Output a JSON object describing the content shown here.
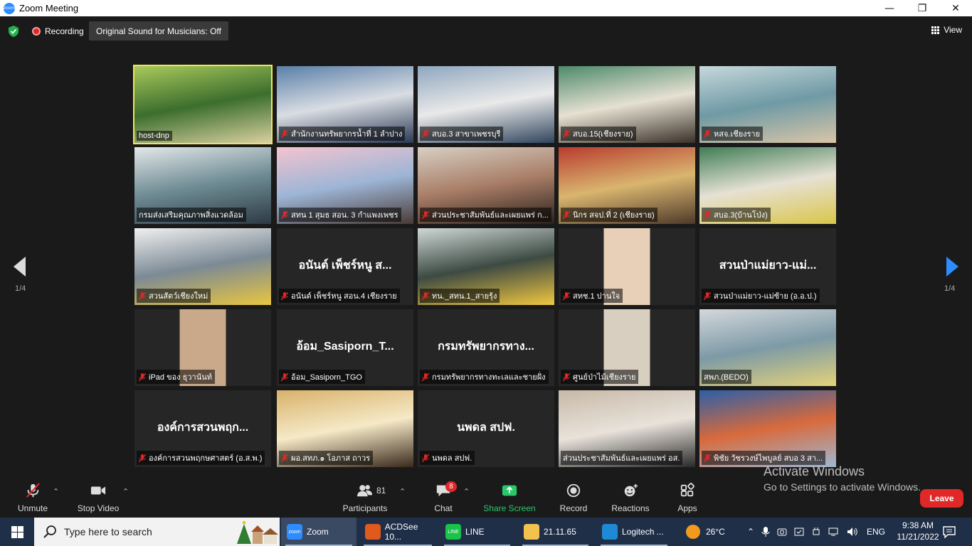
{
  "window": {
    "title": "Zoom Meeting",
    "app_icon_text": "zoom",
    "minimize": "—",
    "maximize": "❐",
    "close": "✕"
  },
  "status": {
    "recording_label": "Recording",
    "original_sound_label": "Original Sound for Musicians: Off",
    "view_label": "View"
  },
  "pager": {
    "left_page": "1/4",
    "right_page": "1/4"
  },
  "tiles": [
    {
      "label": "host-dnp",
      "muted": false,
      "active": true,
      "bg": [
        "#a9c95a",
        "#3c6e2e",
        "#d8d0a0"
      ],
      "bigname": ""
    },
    {
      "label": "สำนักงานทรัพยากรน้ำที่ 1 ลำปาง",
      "muted": true,
      "active": false,
      "bg": [
        "#5a7fa8",
        "#d9dde3",
        "#2b3a55"
      ],
      "bigname": ""
    },
    {
      "label": "สบอ.3 สาขาเพชรบุรี",
      "muted": true,
      "active": false,
      "bg": [
        "#8fa7bf",
        "#e9e9e9",
        "#30455e"
      ],
      "bigname": ""
    },
    {
      "label": "สบอ.15(เชียงราย)",
      "muted": true,
      "active": false,
      "bg": [
        "#4d8a6b",
        "#e6e0d2",
        "#3a3128"
      ],
      "bigname": ""
    },
    {
      "label": "หสจ.เชียงราย",
      "muted": true,
      "active": false,
      "bg": [
        "#c7d8dc",
        "#6f9aa5",
        "#d9c6a7"
      ],
      "bigname": ""
    },
    {
      "label": "กรมส่งเสริมคุณภาพสิ่งแวดล้อม",
      "muted": false,
      "active": false,
      "bg": [
        "#e3e8ea",
        "#6e8b93",
        "#2d3a44"
      ],
      "bigname": ""
    },
    {
      "label": "สทน 1 สุมธ สอน. 3 กำแพงเพชร",
      "muted": true,
      "active": false,
      "bg": [
        "#f3c4cf",
        "#9db5d6",
        "#4a3b36"
      ],
      "bigname": ""
    },
    {
      "label": "ส่วนประชาสัมพันธ์และเผยแพร่ ก...",
      "muted": true,
      "active": false,
      "bg": [
        "#d7cfc4",
        "#a87d66",
        "#2a201c"
      ],
      "bigname": ""
    },
    {
      "label": "นิกร สจป.ที่ 2 (เชียงราย)",
      "muted": true,
      "active": false,
      "bg": [
        "#b83c2f",
        "#d9b56f",
        "#4e3a2a"
      ],
      "bigname": ""
    },
    {
      "label": "สบอ.3(บ้านโป่ง)",
      "muted": true,
      "active": false,
      "bg": [
        "#3f7d56",
        "#e6e1d4",
        "#d9c64a"
      ],
      "bigname": ""
    },
    {
      "label": "สวนสัตว์เชียงใหม่",
      "muted": true,
      "active": false,
      "bg": [
        "#f0f0f0",
        "#7c8a95",
        "#e8c640"
      ],
      "bigname": ""
    },
    {
      "label": "อนันต์ เพ็ชร์หนู สอน.4 เชียงราย",
      "muted": true,
      "active": false,
      "bg": [
        "#262626",
        "#262626",
        "#262626"
      ],
      "bigname": "อนันต์ เพ็ชร์หนู ส..."
    },
    {
      "label": "ทน._สทน.1_สายรุ้ง",
      "muted": true,
      "active": false,
      "bg": [
        "#cfd8d6",
        "#3d4a43",
        "#f0c640"
      ],
      "bigname": ""
    },
    {
      "label": "สทช.1 ปานใจ",
      "muted": true,
      "active": false,
      "bg": [
        "#262626",
        "#e8d0b8",
        "#262626"
      ],
      "bigname": ""
    },
    {
      "label": "สวนป่าแม่ยาว-แม่ซ้าย (อ.อ.ป.)",
      "muted": true,
      "active": false,
      "bg": [
        "#262626",
        "#262626",
        "#262626"
      ],
      "bigname": "สวนป่าแม่ยาว-แม่..."
    },
    {
      "label": "iPad ของ ธุวานันท์",
      "muted": true,
      "active": false,
      "bg": [
        "#262626",
        "#c9a98a",
        "#262626"
      ],
      "bigname": ""
    },
    {
      "label": "อ้อม_Sasiporn_TGO",
      "muted": true,
      "active": false,
      "bg": [
        "#262626",
        "#262626",
        "#262626"
      ],
      "bigname": "อ้อม_Sasiporn_T..."
    },
    {
      "label": "กรมทรัพยากรทางทะเลและชายฝั่ง",
      "muted": true,
      "active": false,
      "bg": [
        "#262626",
        "#262626",
        "#262626"
      ],
      "bigname": "กรมทรัพยากรทาง..."
    },
    {
      "label": "ศูนย์ป่าไม้เชียงราย",
      "muted": true,
      "active": false,
      "bg": [
        "#262626",
        "#d9cfc0",
        "#262626"
      ],
      "bigname": ""
    },
    {
      "label": "สพภ.(BEDO)",
      "muted": false,
      "active": false,
      "bg": [
        "#d4d8dc",
        "#7d9aa6",
        "#e3d37a"
      ],
      "bigname": ""
    },
    {
      "label": "องค์การสวนพฤกษศาสตร์ (อ.ส.พ.)",
      "muted": true,
      "active": false,
      "bg": [
        "#262626",
        "#262626",
        "#262626"
      ],
      "bigname": "องค์การสวนพฤก..."
    },
    {
      "label": "ผอ.สทภ.๑ โอภาส ถาวร",
      "muted": true,
      "active": false,
      "bg": [
        "#d9b26a",
        "#f5e9c7",
        "#3a2a1c"
      ],
      "bigname": ""
    },
    {
      "label": "นพดล สปฟ.",
      "muted": true,
      "active": false,
      "bg": [
        "#262626",
        "#262626",
        "#262626"
      ],
      "bigname": "นพดล สปฟ."
    },
    {
      "label": "ส่วนประชาสัมพันธ์และเผยแพร่ อส.",
      "muted": false,
      "active": false,
      "bg": [
        "#c8b9a8",
        "#e8e2da",
        "#2a2a2a"
      ],
      "bigname": ""
    },
    {
      "label": "พิชัย วัชรวงษ์ไพบูลย์ สบอ 3 สา...",
      "muted": true,
      "active": false,
      "bg": [
        "#2c5fa8",
        "#d86a3c",
        "#9fb8d4"
      ],
      "bigname": ""
    }
  ],
  "toolbar": {
    "unmute": "Unmute",
    "stop_video": "Stop Video",
    "participants": "Participants",
    "participants_count": "81",
    "chat": "Chat",
    "chat_badge": "8",
    "share_screen": "Share Screen",
    "record": "Record",
    "reactions": "Reactions",
    "apps": "Apps",
    "leave": "Leave",
    "share_color": "#2ac86b"
  },
  "activation": {
    "line1": "Activate Windows",
    "line2": "Go to Settings to activate Windows."
  },
  "taskbar": {
    "search_placeholder": "Type here to search",
    "apps": [
      {
        "label": "Zoom",
        "icon_text": "zoom",
        "color": "#2d8cff"
      },
      {
        "label": "ACDSee 10...",
        "icon_text": "",
        "color": "#e05a1e"
      },
      {
        "label": "LINE",
        "icon_text": "LINE",
        "color": "#19c34a"
      },
      {
        "label": "21.11.65",
        "icon_text": "",
        "color": "#f2c14e"
      },
      {
        "label": "Logitech ...",
        "icon_text": "",
        "color": "#1e8ad6"
      }
    ],
    "weather": "26°C",
    "language": "ENG",
    "time": "9:38 AM",
    "date": "11/21/2022"
  }
}
